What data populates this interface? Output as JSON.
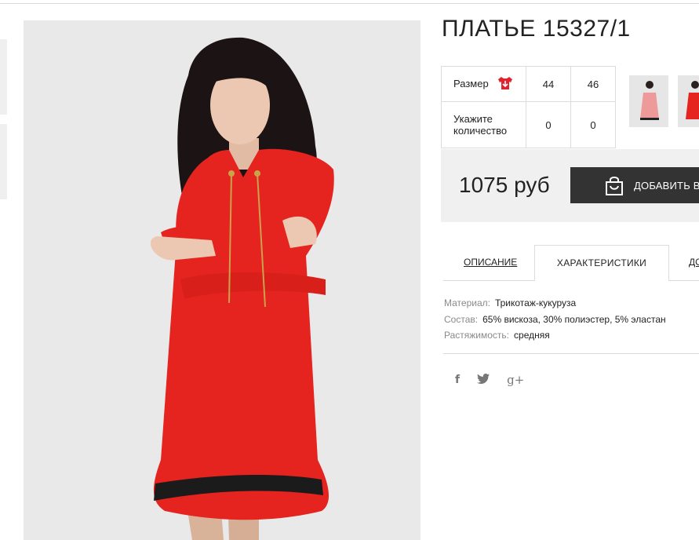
{
  "product": {
    "title": "ПЛАТЬЕ 15327/1",
    "price": "1075 руб"
  },
  "size_table": {
    "size_label": "Размер",
    "qty_label_line1": "Укажите",
    "qty_label_line2": "количество",
    "sizes": [
      "44",
      "46"
    ],
    "quantities": [
      "0",
      "0"
    ]
  },
  "cart": {
    "button_label": "ДОБАВИТЬ В"
  },
  "tabs": {
    "description": "ОПИСАНИЕ",
    "characteristics": "ХАРАКТЕРИСТИКИ",
    "more": "ДО"
  },
  "specs": [
    {
      "label": "Материал:",
      "value": "Трикотаж-кукуруза"
    },
    {
      "label": "Состав:",
      "value": "65% вискоза, 30% полиэстер, 5% эластан"
    },
    {
      "label": "Растяжимость:",
      "value": "средняя"
    }
  ],
  "social": {
    "facebook": "f",
    "twitter": "🐦",
    "googleplus": "g+"
  },
  "colors": {
    "dress_red": "#e5241f",
    "button_dark": "#333333",
    "panel_gray": "#f0f0f0",
    "size_icon_red": "#e0232c"
  },
  "icons": [
    "size-guide-icon",
    "shopping-bag-icon",
    "facebook-icon",
    "twitter-icon",
    "google-plus-icon"
  ]
}
